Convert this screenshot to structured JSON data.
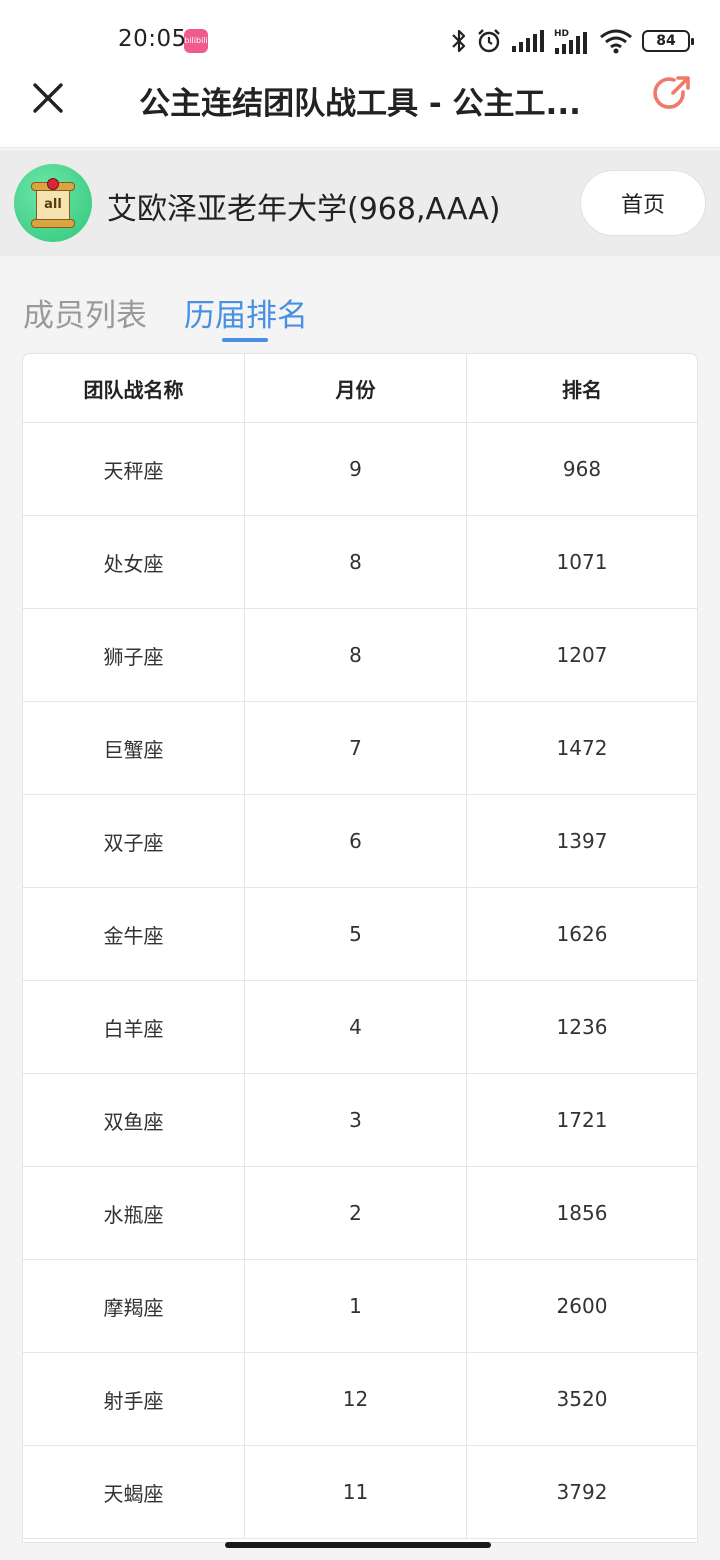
{
  "status_bar": {
    "time": "20:05",
    "app_badge": "bilibili",
    "battery": "84"
  },
  "nav": {
    "title": "公主连结团队战工具 - 公主工..."
  },
  "clan": {
    "avatar_text": "all",
    "name": "艾欧泽亚老年大学(968,AAA)",
    "home_button": "首页"
  },
  "tabs": [
    {
      "label": "成员列表",
      "active": false
    },
    {
      "label": "历届排名",
      "active": true
    }
  ],
  "table": {
    "headers": [
      "团队战名称",
      "月份",
      "排名"
    ],
    "rows": [
      [
        "天秤座",
        "9",
        "968"
      ],
      [
        "处女座",
        "8",
        "1071"
      ],
      [
        "狮子座",
        "8",
        "1207"
      ],
      [
        "巨蟹座",
        "7",
        "1472"
      ],
      [
        "双子座",
        "6",
        "1397"
      ],
      [
        "金牛座",
        "5",
        "1626"
      ],
      [
        "白羊座",
        "4",
        "1236"
      ],
      [
        "双鱼座",
        "3",
        "1721"
      ],
      [
        "水瓶座",
        "2",
        "1856"
      ],
      [
        "摩羯座",
        "1",
        "2600"
      ],
      [
        "射手座",
        "12",
        "3520"
      ],
      [
        "天蝎座",
        "11",
        "3792"
      ]
    ]
  },
  "colors": {
    "accent": "#4a90e2",
    "share_icon": "#f07a6a",
    "avatar_bg": "#2fc77c"
  },
  "icons": {
    "close": "close-icon",
    "share": "share-icon",
    "bluetooth": "bluetooth-icon",
    "alarm": "alarm-icon",
    "signal": "signal-icon",
    "wifi": "wifi-icon"
  }
}
